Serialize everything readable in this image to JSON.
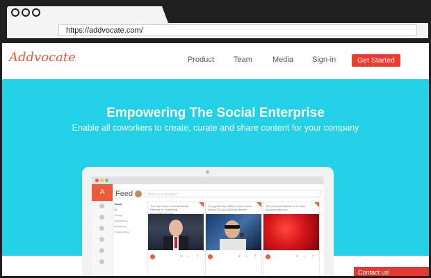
{
  "browser": {
    "url": "https://addvocate.com/"
  },
  "site": {
    "logo": "Addvocate",
    "nav": [
      "Product",
      "Team",
      "Media",
      "Sign-in"
    ],
    "cta": "Get Started"
  },
  "hero": {
    "title": "Empowering The Social Enterprise",
    "subtitle": "Enable all coworkers to create, curate and share content for your company"
  },
  "app": {
    "logo": "A",
    "feed_title": "Feed",
    "post_placeholder": "What's your thought?",
    "categories": [
      "Teams",
      "All",
      "Design",
      "Operations",
      "Marketing",
      "Engineering"
    ],
    "cards": [
      {
        "title": "The Two Sides of Social Media: Filtering vs. Marketing  adv.r.a/sbr.sby.com"
      },
      {
        "title": "Young Will See OBM & New Coffee House To Live Out Bold Memes"
      },
      {
        "title": "The Constant Market In To Critic adv.a/sbr.sby.com"
      }
    ]
  },
  "contact": "Contact us!",
  "colors": {
    "accent": "#ef5a3c",
    "hero": "#22d1e6",
    "cta": "#ef3b2d"
  }
}
